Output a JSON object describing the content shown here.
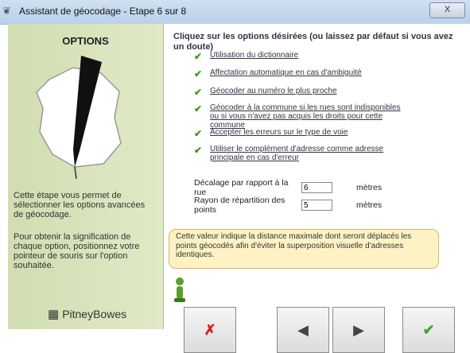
{
  "window": {
    "title": "Assistant de géocodage - Etape 6 sur 8",
    "close_label": "X"
  },
  "left_panel": {
    "title": "OPTIONS",
    "help_text_1": "Cette étape vous permet de sélectionner les options avancées de géocodage.",
    "help_text_2": "Pour obtenir la signification de chaque option, positionnez votre pointeur de souris sur l'option souhaitée.",
    "logo_text": "PitneyBowes"
  },
  "main": {
    "heading": "Cliquez sur les options désirées (ou laissez par défaut si vous avez un doute)",
    "options": [
      {
        "label": "Utilisation du dictionnaire",
        "checked": true
      },
      {
        "label": "Affectation automatique en cas d'ambiguité",
        "checked": true
      },
      {
        "label": "Géocoder au numéro le plus proche",
        "checked": true
      },
      {
        "label": "Géocoder à la commune si les rues sont indisponibles ou si vous n'avez pas acquis les droits pour cette commune",
        "checked": true
      },
      {
        "label": "Accepter les erreurs sur le type de voie",
        "checked": true
      },
      {
        "label": "Utiliser le complément d'adresse comme adresse principale en cas d'erreur",
        "checked": true
      }
    ],
    "fields": [
      {
        "label": "Décalage par rapport à la rue",
        "value": "6",
        "unit": "mètres"
      },
      {
        "label": "Rayon de répartition des points",
        "value": "5",
        "unit": "mètres"
      }
    ],
    "tooltip": "Cette valeur indique la distance maximale dont seront déplacés les points géocodés afin d'éviter la superposition visuelle d'adresses identiques."
  },
  "buttons": {
    "cancel": "✗",
    "previous": "◀",
    "next": "▶",
    "finish": "✔"
  },
  "colors": {
    "check": "#3a9b1a",
    "cancel": "#d81f1f",
    "tooltip_bg": "#fdf2c4"
  }
}
